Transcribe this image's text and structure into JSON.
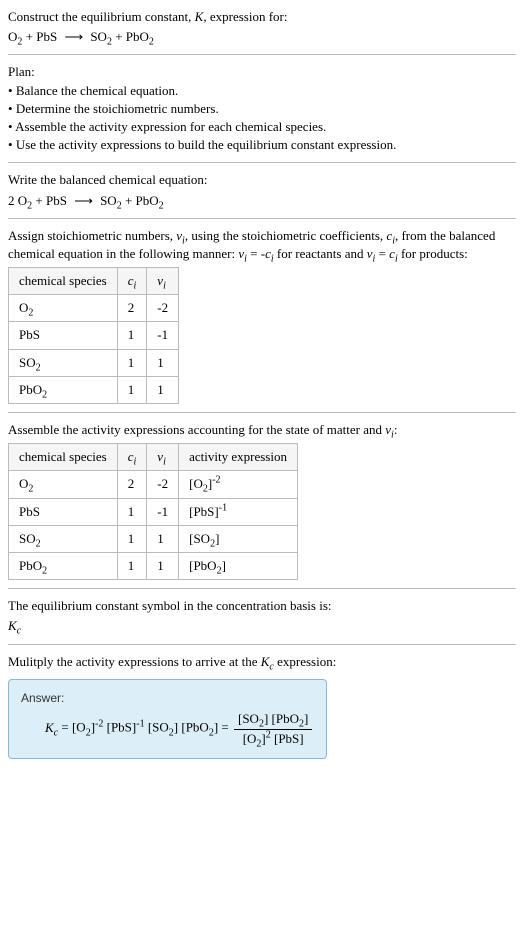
{
  "intro": {
    "line1": "Construct the equilibrium constant, K, expression for:",
    "reaction_lhs": "O₂ + PbS",
    "reaction_arrow": "⟶",
    "reaction_rhs": "SO₂ + PbO₂"
  },
  "plan": {
    "heading": "Plan:",
    "items": [
      "Balance the chemical equation.",
      "Determine the stoichiometric numbers.",
      "Assemble the activity expression for each chemical species.",
      "Use the activity expressions to build the equilibrium constant expression."
    ]
  },
  "balanced": {
    "text": "Write the balanced chemical equation:",
    "reaction_lhs": "2 O₂ + PbS",
    "reaction_arrow": "⟶",
    "reaction_rhs": "SO₂ + PbO₂"
  },
  "stoich": {
    "text_a": "Assign stoichiometric numbers, νᵢ, using the stoichiometric coefficients, cᵢ, from the balanced chemical equation in the following manner: νᵢ = -cᵢ for reactants and νᵢ = cᵢ for products:",
    "headers": [
      "chemical species",
      "cᵢ",
      "νᵢ"
    ],
    "rows": [
      {
        "species": "O₂",
        "ci": "2",
        "vi": "-2"
      },
      {
        "species": "PbS",
        "ci": "1",
        "vi": "-1"
      },
      {
        "species": "SO₂",
        "ci": "1",
        "vi": "1"
      },
      {
        "species": "PbO₂",
        "ci": "1",
        "vi": "1"
      }
    ]
  },
  "activity": {
    "text": "Assemble the activity expressions accounting for the state of matter and νᵢ:",
    "headers": [
      "chemical species",
      "cᵢ",
      "νᵢ",
      "activity expression"
    ],
    "rows": [
      {
        "species": "O₂",
        "ci": "2",
        "vi": "-2",
        "expr": "[O₂]⁻²"
      },
      {
        "species": "PbS",
        "ci": "1",
        "vi": "-1",
        "expr": "[PbS]⁻¹"
      },
      {
        "species": "SO₂",
        "ci": "1",
        "vi": "1",
        "expr": "[SO₂]"
      },
      {
        "species": "PbO₂",
        "ci": "1",
        "vi": "1",
        "expr": "[PbO₂]"
      }
    ]
  },
  "eqconst": {
    "text": "The equilibrium constant symbol in the concentration basis is:",
    "symbol": "K_c"
  },
  "multiply": {
    "text": "Mulitply the activity expressions to arrive at the K_c expression:"
  },
  "answer": {
    "label": "Answer:",
    "lhs": "K_c = [O₂]⁻² [PbS]⁻¹ [SO₂] [PbO₂] =",
    "num": "[SO₂] [PbO₂]",
    "den": "[O₂]² [PbS]"
  }
}
